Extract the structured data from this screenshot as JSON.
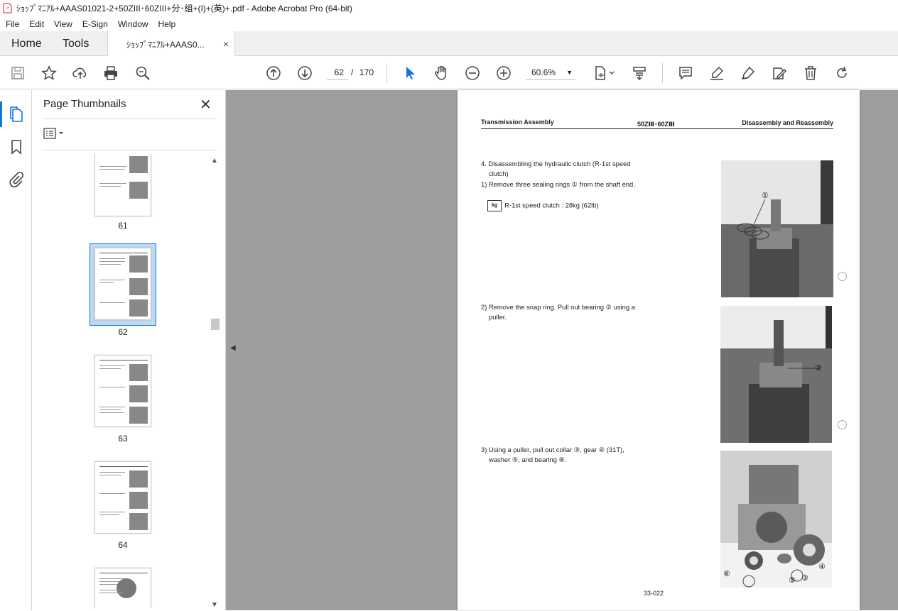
{
  "window": {
    "title": "ｼｮｯﾌﾟﾏﾆｱﾙ+AAAS01021-2+50ZIII･60ZIII+分･組+(I)+(英)+.pdf - Adobe Acrobat Pro (64-bit)"
  },
  "menu": [
    "File",
    "Edit",
    "View",
    "E-Sign",
    "Window",
    "Help"
  ],
  "tabs": {
    "home": "Home",
    "tools": "Tools",
    "document": "ｼｮｯﾌﾟﾏﾆｱﾙ+AAAS0...",
    "close": "×"
  },
  "toolbar": {
    "current_page": "62",
    "page_separator": "/",
    "total_pages": "170",
    "zoom": "60.6%"
  },
  "panel": {
    "title": "Page Thumbnails",
    "close": "✕",
    "thumbnails": [
      {
        "label": "61"
      },
      {
        "label": "62",
        "selected": true
      },
      {
        "label": "63"
      },
      {
        "label": "64"
      }
    ]
  },
  "page": {
    "header_left": "Transmission Assembly",
    "header_mid": "50ZⅢ･60ZⅢ",
    "header_right": "Disassembly and Reassembly",
    "step4_line1": "4. Disassembling the hydraulic clutch (R-1st speed",
    "step4_line2": "clutch)",
    "step1": "1)  Remove three sealing rings ① from the shaft end.",
    "kg_label": "kg",
    "weight": "R-1st speed clutch : 28kg (62lb)",
    "step2_line1": "2) Remove the snap ring. Pull out bearing ② using a",
    "step2_line2": "puller.",
    "step3_line1": "3) Using a puller, pull out collar ③, gear ④ (31T),",
    "step3_line2": "washer ⑤, and bearing ⑥.",
    "callout1": "①",
    "callout2": "②",
    "callout3": "③",
    "callout4": "④",
    "callout5": "⑤",
    "callout6": "⑥",
    "footer": "33-022"
  }
}
